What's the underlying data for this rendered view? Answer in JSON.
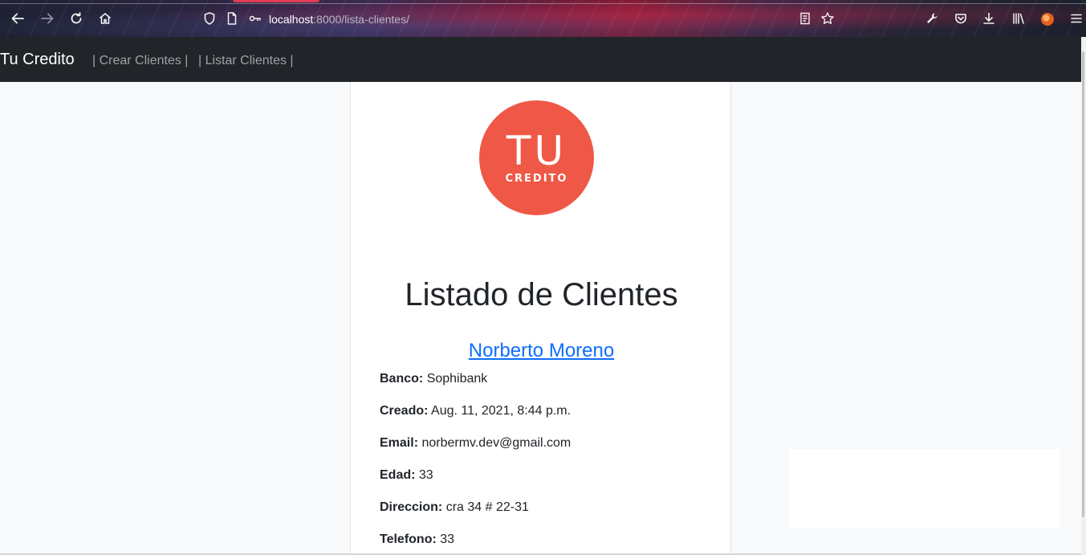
{
  "browser": {
    "url_host": "localhost",
    "url_rest": ":8000/lista-clientes/",
    "icons": [
      "back-arrow-icon",
      "forward-arrow-icon",
      "reload-icon",
      "home-icon",
      "shield-icon",
      "page-icon",
      "connection-icon",
      "reader-view-icon",
      "bookmark-star-icon",
      "wrench-icon",
      "pocket-icon",
      "download-icon",
      "library-icon",
      "extension-icon",
      "menu-icon"
    ]
  },
  "navbar": {
    "brand": "Tu Credito",
    "links": [
      "| Crear Clientes |",
      "| Listar Clientes |"
    ]
  },
  "logo": {
    "main": "TU",
    "sub": "CREDITO",
    "color": "#ef5846"
  },
  "page": {
    "title": "Listado de Clientes"
  },
  "client": {
    "name": "Norberto Moreno",
    "fields": [
      {
        "label": "Banco:",
        "value": "Sophibank"
      },
      {
        "label": "Creado:",
        "value": "Aug. 11, 2021, 8:44 p.m."
      },
      {
        "label": "Email:",
        "value": "norbermv.dev@gmail.com"
      },
      {
        "label": "Edad:",
        "value": "33"
      },
      {
        "label": "Direccion:",
        "value": "cra 34 # 22-31"
      },
      {
        "label": "Telefono:",
        "value": "33"
      }
    ]
  },
  "colors": {
    "navbar_bg": "#212529",
    "link": "#0d6efd",
    "logo": "#ef5846"
  }
}
